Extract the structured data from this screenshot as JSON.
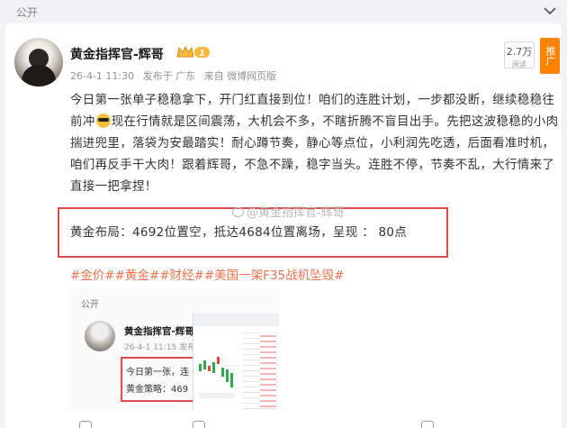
{
  "visibility": "公开",
  "post": {
    "author": "黄金指挥官-辉哥",
    "date": "26-4-1 11:30",
    "published_from": "发布于 广东",
    "source": "来自 微博网页版",
    "read_count": "2.7万",
    "read_label": "阅读",
    "promote_label": "推广",
    "text_part1": "今日第一张单子稳稳拿下，开门红直接到位！咱们的连胜计划，一步都没断，继续稳稳往前冲",
    "emoji_icon": "cool-sunglasses-emoji",
    "text_part2": "现在行情就是区间震荡，大机会不多，不瞎折腾不盲目出手。先把这波稳稳的小肉揣进兜里，落袋为安最踏实！耐心蹲节奏，静心等点位，小利润先吃透，后面看准时机，咱们再反手干大肉！跟着辉哥，不急不躁，稳字当头。连胜不停，节奏不乱，大行情来了直接一把拿捏！",
    "strategy": "黄金布局：4692位置空，抵达4684位置离场，呈现 ： 80点",
    "watermark": "@黄金指挥官-辉哥",
    "hashtags": [
      "#金价#",
      "#黄金#",
      "#财经#",
      "#美国一架F35战机坠毁#"
    ]
  },
  "embedded": {
    "visibility": "公开",
    "author": "黄金指挥官-辉哥",
    "date": "26-4-1 11:15",
    "source_short": "发布",
    "line1": "今日第一张，连",
    "line2": "黄金策略：469"
  },
  "colors": {
    "hashtag": "#eb7350",
    "highlight_border": "#e04a4a",
    "promote": "#ff8200"
  }
}
